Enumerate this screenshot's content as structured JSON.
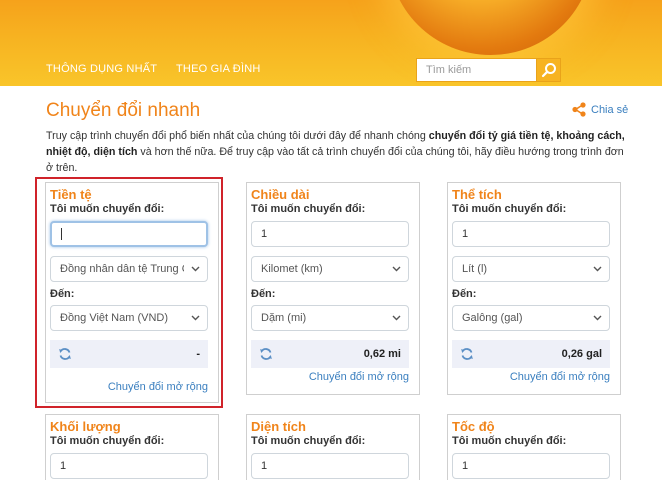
{
  "nav": {
    "items": [
      "THÔNG DỤNG NHẤT",
      "THEO GIA ĐÌNH"
    ],
    "search_placeholder": "Tìm kiếm"
  },
  "page": {
    "title": "Chuyển đổi nhanh",
    "share_label": "Chia sẻ",
    "intro": {
      "part1": "Truy cập trình chuyển đổi phổ biến nhất của chúng tôi dưới đây để nhanh chóng ",
      "bold1": "chuyển đổi tỷ giá tiền tệ, khoảng cách, nhiệt độ, diện tích",
      "part2": " và hơn thế nữa. Để truy cập vào tất cả trình chuyển đổi của chúng tôi, hãy điều hướng trong trình đơn ở trên."
    }
  },
  "cards": [
    {
      "title": "Tiền tệ",
      "from_label": "Tôi muốn chuyển đổi:",
      "input_value": "",
      "from_unit": "Đồng nhân dân tệ Trung Quốc (CNY)",
      "to_label": "Đến:",
      "to_unit": "Đồng Việt Nam (VND)",
      "result": "-",
      "advanced": "Chuyển đổi mở rộng"
    },
    {
      "title": "Chiều dài",
      "from_label": "Tôi muốn chuyển đổi:",
      "input_value": "1",
      "from_unit": "Kilomet (km)",
      "to_label": "Đến:",
      "to_unit": "Dặm (mi)",
      "result": "0,62 mi",
      "advanced": "Chuyển đổi mở rộng"
    },
    {
      "title": "Thể tích",
      "from_label": "Tôi muốn chuyển đổi:",
      "input_value": "1",
      "from_unit": "Lít (l)",
      "to_label": "Đến:",
      "to_unit": "Galông (gal)",
      "result": "0,26 gal",
      "advanced": "Chuyển đổi mở rộng"
    },
    {
      "title": "Khối lượng",
      "from_label": "Tôi muốn chuyển đổi:",
      "input_value": "1"
    },
    {
      "title": "Diện tích",
      "from_label": "Tôi muốn chuyển đổi:",
      "input_value": "1"
    },
    {
      "title": "Tốc độ",
      "from_label": "Tôi muốn chuyển đổi:",
      "input_value": "1"
    }
  ],
  "icons": {
    "search": "search-icon",
    "share": "share-icon",
    "refresh": "refresh-icon",
    "chevron": "chevron-down-icon"
  },
  "colors": {
    "brand_orange": "#f0841a",
    "header_yellow": "#f7b321",
    "link_blue": "#3a7fbf",
    "highlight_red": "#d0232a"
  }
}
